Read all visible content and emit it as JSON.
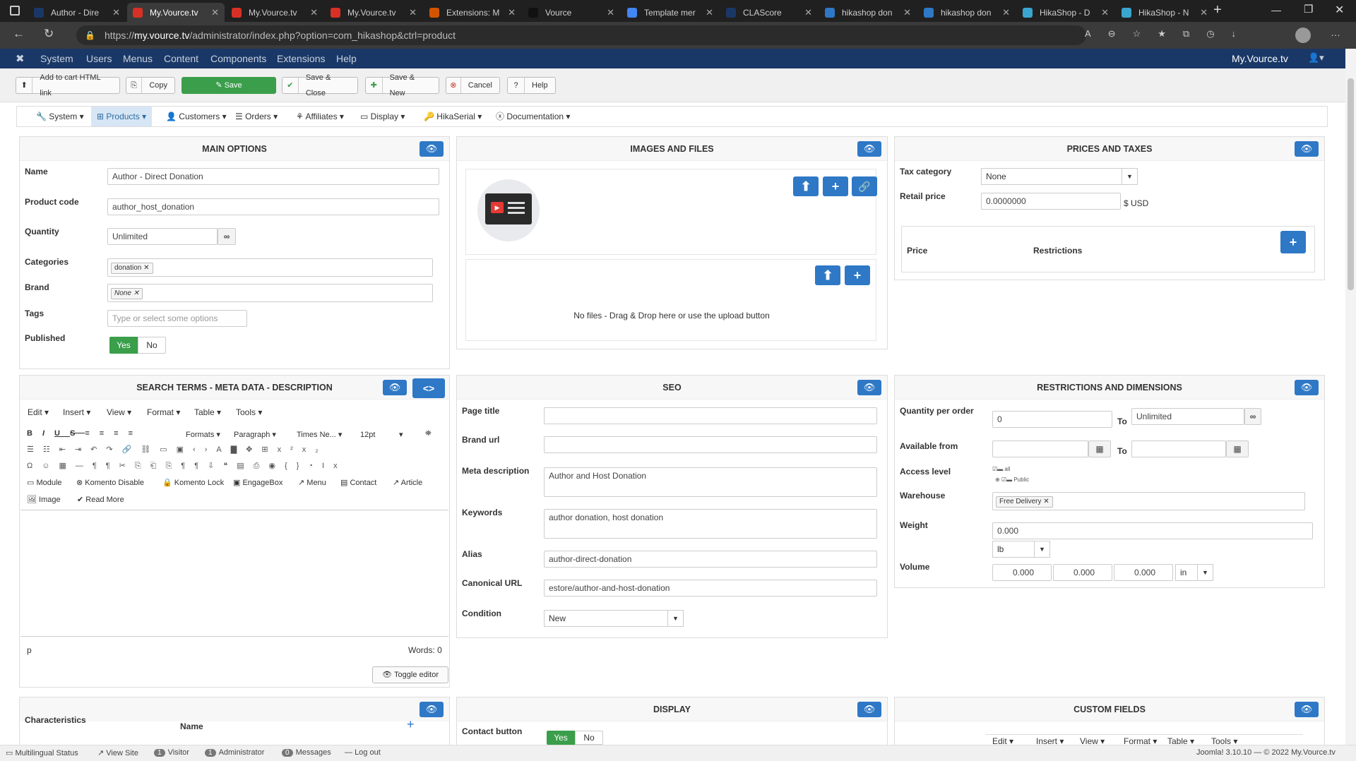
{
  "browser": {
    "tabs": [
      {
        "title": "Author - Dire",
        "icon": "joomla-icon",
        "color": "#1a3867"
      },
      {
        "title": "My.Vource.tv",
        "icon": "gmail-icon",
        "color": "#d93025"
      },
      {
        "title": "My.Vource.tv",
        "icon": "gmail-icon",
        "color": "#d93025"
      },
      {
        "title": "My.Vource.tv",
        "icon": "gmail-icon",
        "color": "#d93025"
      },
      {
        "title": "Extensions: M",
        "icon": "extensions-icon",
        "color": "#d35400"
      },
      {
        "title": "Vource",
        "icon": "vource-icon",
        "color": "#111111"
      },
      {
        "title": "Template mer",
        "icon": "chrome-icon",
        "color": "#4285f4"
      },
      {
        "title": "CLAScore",
        "icon": "clascore-icon",
        "color": "#1a3867"
      },
      {
        "title": "hikashop don",
        "icon": "search-icon",
        "color": "#2e78c6"
      },
      {
        "title": "hikashop don",
        "icon": "search-icon",
        "color": "#2e78c6"
      },
      {
        "title": "HikaShop - D",
        "icon": "hikashop-icon",
        "color": "#3aa6d0"
      },
      {
        "title": "HikaShop - N",
        "icon": "hikashop-icon",
        "color": "#3aa6d0"
      }
    ],
    "url_prefix": "https://",
    "url_host": "my.vource.tv",
    "url_rest": "/administrator/index.php?option=com_hikashop&ctrl=product"
  },
  "joomla": {
    "menu": [
      "System",
      "Users",
      "Menus",
      "Content",
      "Components",
      "Extensions",
      "Help"
    ],
    "site_link": "My.Vource.tv"
  },
  "toolbar": {
    "add_cart": "Add to cart HTML link",
    "copy": "Copy",
    "save": "Save",
    "save_close": "Save & Close",
    "save_new": "Save & New",
    "cancel": "Cancel",
    "help": "Help"
  },
  "subnav": [
    "System",
    "Products",
    "Customers",
    "Orders",
    "Affiliates",
    "Display",
    "HikaSerial",
    "Documentation"
  ],
  "main_options": {
    "title": "MAIN OPTIONS",
    "name_label": "Name",
    "name_value": "Author - Direct Donation",
    "code_label": "Product code",
    "code_value": "author_host_donation",
    "qty_label": "Quantity",
    "qty_value": "Unlimited",
    "cat_label": "Categories",
    "cat_tag": "donation",
    "brand_label": "Brand",
    "brand_tag": "None",
    "tags_label": "Tags",
    "tags_placeholder": "Type or select some options",
    "published_label": "Published",
    "yes": "Yes",
    "no": "No"
  },
  "images": {
    "title": "IMAGES AND FILES",
    "no_files": "No files - Drag & Drop here or use the upload button"
  },
  "prices": {
    "title": "PRICES AND TAXES",
    "tax_label": "Tax category",
    "tax_value": "None",
    "retail_label": "Retail price",
    "retail_value": "0.0000000",
    "currency": "$ USD",
    "price_col": "Price",
    "restrictions_col": "Restrictions"
  },
  "meta": {
    "title": "SEARCH TERMS - META DATA - DESCRIPTION",
    "menus": [
      "Edit",
      "Insert",
      "View",
      "Format",
      "Table",
      "Tools"
    ],
    "formats": "Formats",
    "paragraph": "Paragraph",
    "font": "Times Ne...",
    "size": "12pt",
    "plugins": [
      "Module",
      "Komento Disable",
      "Komento Lock",
      "EngageBox",
      "Menu",
      "Contact",
      "Article"
    ],
    "image": "Image",
    "readmore": "Read More",
    "path": "p",
    "words": "Words: 0",
    "toggle": "Toggle editor"
  },
  "seo": {
    "title": "SEO",
    "page_title_label": "Page title",
    "brand_url_label": "Brand url",
    "meta_desc_label": "Meta description",
    "meta_desc_value": "Author and Host Donation",
    "keywords_label": "Keywords",
    "keywords_value": "author donation, host donation",
    "alias_label": "Alias",
    "alias_value": "author-direct-donation",
    "canonical_label": "Canonical URL",
    "canonical_value": "estore/author-and-host-donation",
    "condition_label": "Condition",
    "condition_value": "New"
  },
  "restrictions": {
    "title": "RESTRICTIONS AND DIMENSIONS",
    "qpo_label": "Quantity per order",
    "qpo_min": "0",
    "to": "To",
    "qpo_max": "Unlimited",
    "avail_label": "Available from",
    "access_label": "Access level",
    "access_all": "all",
    "access_public": "Public",
    "warehouse_label": "Warehouse",
    "warehouse_tag": "Free Delivery",
    "weight_label": "Weight",
    "weight_value": "0.000",
    "weight_unit": "lb",
    "volume_label": "Volume",
    "vol1": "0.000",
    "vol2": "0.000",
    "vol3": "0.000",
    "vol_unit": "in"
  },
  "characteristics": {
    "label": "Characteristics",
    "name_col": "Name"
  },
  "display": {
    "title": "DISPLAY",
    "contact_label": "Contact button",
    "yes": "Yes",
    "no": "No"
  },
  "custom": {
    "title": "CUSTOM FIELDS",
    "menus": [
      "Edit",
      "Insert",
      "View",
      "Format",
      "Table",
      "Tools"
    ]
  },
  "footer": {
    "multilingual": "Multilingual Status",
    "view_site": "View Site",
    "visitor_count": "1",
    "visitor": "Visitor",
    "admin_count": "1",
    "admin": "Administrator",
    "msg_count": "0",
    "messages": "Messages",
    "logout": "Log out",
    "copyright": "Joomla! 3.10.10 — © 2022 My.Vource.tv"
  }
}
